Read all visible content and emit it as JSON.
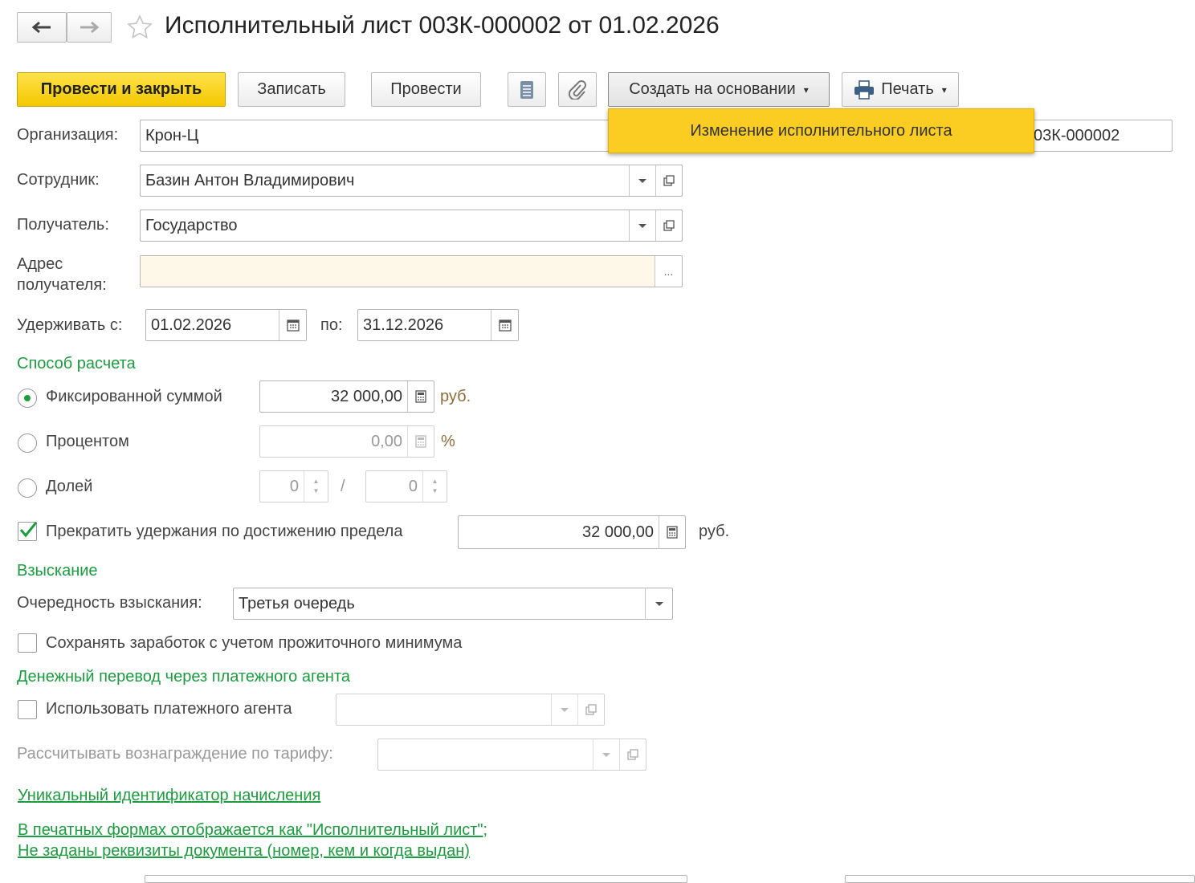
{
  "header": {
    "title": "Исполнительный лист 003К-000002 от 01.02.2026"
  },
  "toolbar": {
    "post_close": "Провести и закрыть",
    "save": "Записать",
    "post": "Провести",
    "create_based": "Создать на основании",
    "print": "Печать"
  },
  "dropdown_menu": {
    "item": "Изменение исполнительного листа"
  },
  "form": {
    "org_label": "Организация:",
    "org_value": "Крон-Ц",
    "number_value": "03К-000002",
    "employee_label": "Сотрудник:",
    "employee_value": "Базин Антон Владимирович",
    "recipient_label": "Получатель:",
    "recipient_value": "Государство",
    "address_label_1": "Адрес",
    "address_label_2": "получателя:",
    "address_value": "",
    "address_btn": "...",
    "hold_from_label": "Удерживать с:",
    "hold_from_value": "01.02.2026",
    "hold_to_label": "по:",
    "hold_to_value": "31.12.2026"
  },
  "calc": {
    "section": "Способ расчета",
    "fixed_label": "Фиксированной суммой",
    "fixed_value": "32 000,00",
    "fixed_unit": "руб.",
    "percent_label": "Процентом",
    "percent_value": "0,00",
    "percent_unit": "%",
    "share_label": "Долей",
    "share_num": "0",
    "share_sep": "/",
    "share_den": "0",
    "limit_label": "Прекратить удержания по достижению предела",
    "limit_value": "32 000,00",
    "limit_unit": "руб."
  },
  "collection": {
    "section": "Взыскание",
    "priority_label": "Очередность взыскания:",
    "priority_value": "Третья очередь",
    "keep_min_label": "Сохранять заработок с учетом прожиточного минимума"
  },
  "agent": {
    "section": "Денежный перевод через платежного агента",
    "use_label": "Использовать платежного агента",
    "use_value": "",
    "fee_label": "Рассчитывать вознаграждение по тарифу:",
    "fee_value": ""
  },
  "links": {
    "uid": "Уникальный идентификатор начисления",
    "print_forms": "В печатных формах отображается как \"Исполнительный лист\";",
    "requisites": "Не заданы реквизиты документа (номер, кем и когда выдан)"
  }
}
